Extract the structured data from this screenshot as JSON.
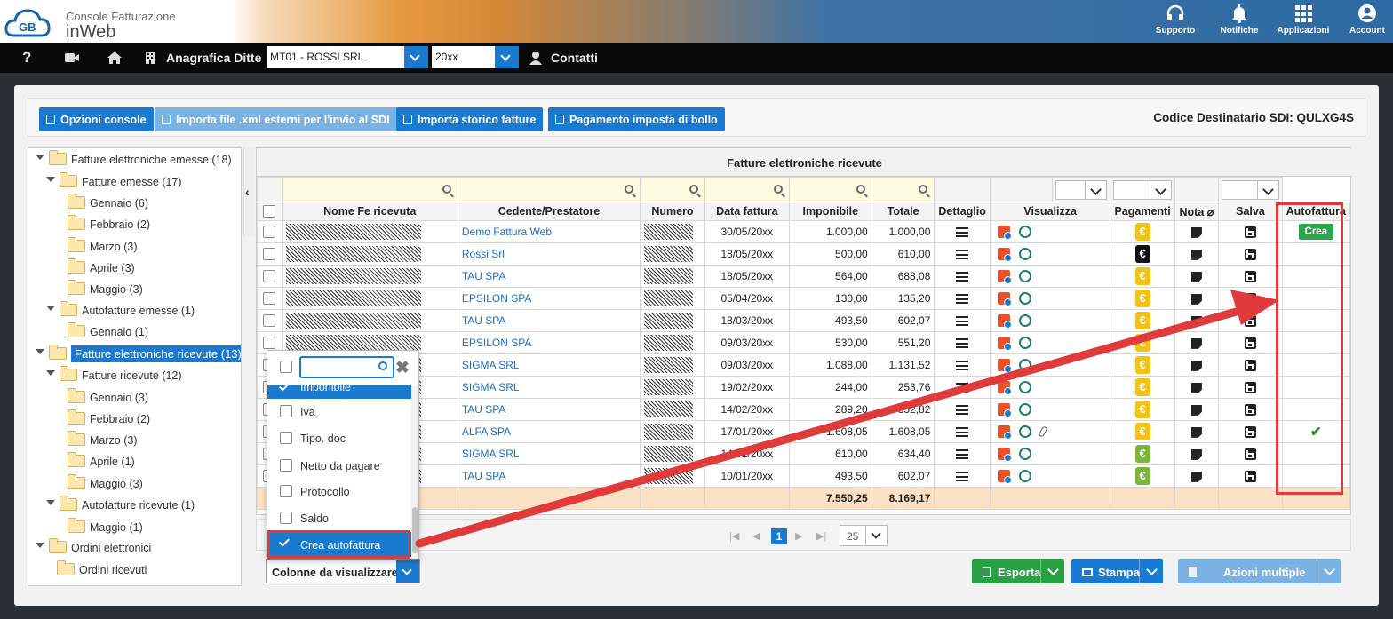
{
  "app": {
    "brand_line1": "Console Fatturazione",
    "brand_line2": "inWeb",
    "logo_text": "GB"
  },
  "top_actions": [
    {
      "label": "Supporto",
      "icon": "headset-icon"
    },
    {
      "label": "Notifiche",
      "icon": "bell-icon"
    },
    {
      "label": "Applicazioni",
      "icon": "apps-grid-icon"
    },
    {
      "label": "Account",
      "icon": "user-circle-icon"
    }
  ],
  "nav": {
    "help": "?",
    "anagrafica": "Anagrafica Ditte",
    "company_value": "MT01 - ROSSI SRL",
    "year_value": "20xx",
    "contatti": "Contatti"
  },
  "toolbar": {
    "buttons": [
      "Opzioni console",
      "Importa file .xml esterni per l'invio al SDI",
      "Importa storico fatture",
      "Pagamento imposta di bollo"
    ],
    "sdi": "Codice Destinatario SDI: QULXG4S"
  },
  "tree": [
    "Fatture elettroniche emesse (18)",
    "Fatture emesse (17)",
    "Gennaio (6)",
    "Febbraio (2)",
    "Marzo (3)",
    "Aprile (3)",
    "Maggio (3)",
    "Autofatture emesse (1)",
    "Gennaio (1)",
    "Fatture elettroniche ricevute (13)",
    "Fatture ricevute (12)",
    "Gennaio (3)",
    "Febbraio (2)",
    "Marzo (3)",
    "Aprile (1)",
    "Maggio (3)",
    "Autofatture ricevute (1)",
    "Maggio (1)",
    "Ordini elettronici",
    "Ordini ricevuti"
  ],
  "grid": {
    "title": "Fatture elettroniche ricevute",
    "columns": [
      "Nome Fe ricevuta",
      "Cedente/Prestatore",
      "Numero",
      "Data fattura",
      "Imponibile",
      "Totale",
      "Dettaglio",
      "Visualizza",
      "Pagamenti",
      "Nota",
      "Salva",
      "Autofattura"
    ],
    "rows": [
      {
        "cedente": "Demo Fattura Web",
        "data": "30/05/20xx",
        "imponibile": "1.000,00",
        "totale": "1.000,00",
        "pag": "yellow",
        "auto": "Crea"
      },
      {
        "cedente": "Rossi Srl",
        "data": "18/05/20xx",
        "imponibile": "500,00",
        "totale": "610,00",
        "pag": "black",
        "auto": ""
      },
      {
        "cedente": "TAU SPA",
        "data": "18/05/20xx",
        "imponibile": "564,00",
        "totale": "688,08",
        "pag": "yellow",
        "auto": ""
      },
      {
        "cedente": "EPSILON SPA",
        "data": "05/04/20xx",
        "imponibile": "130,00",
        "totale": "135,20",
        "pag": "yellow",
        "auto": ""
      },
      {
        "cedente": "TAU SPA",
        "data": "18/03/20xx",
        "imponibile": "493,50",
        "totale": "602,07",
        "pag": "yellow",
        "auto": ""
      },
      {
        "cedente": "EPSILON SPA",
        "data": "09/03/20xx",
        "imponibile": "530,00",
        "totale": "551,20",
        "pag": "yellow",
        "auto": ""
      },
      {
        "cedente": "SIGMA SRL",
        "data": "09/03/20xx",
        "imponibile": "1.088,00",
        "totale": "1.131,52",
        "pag": "yellow",
        "auto": ""
      },
      {
        "cedente": "SIGMA SRL",
        "data": "19/02/20xx",
        "imponibile": "244,00",
        "totale": "253,76",
        "pag": "yellow",
        "auto": ""
      },
      {
        "cedente": "TAU SPA",
        "data": "14/02/20xx",
        "imponibile": "289,20",
        "totale": "352,82",
        "pag": "yellow",
        "auto": ""
      },
      {
        "cedente": "ALFA SPA",
        "data": "17/01/20xx",
        "imponibile": "1.608,05",
        "totale": "1.608,05",
        "pag": "yellow",
        "auto": "✔",
        "clip": true
      },
      {
        "cedente": "SIGMA SRL",
        "data": "14/01/20xx",
        "imponibile": "610,00",
        "totale": "634,40",
        "pag": "green",
        "auto": ""
      },
      {
        "cedente": "TAU SPA",
        "data": "10/01/20xx",
        "imponibile": "493,50",
        "totale": "602,07",
        "pag": "green",
        "auto": ""
      }
    ],
    "totals": {
      "imponibile": "7.550,25",
      "totale": "8.169,17"
    }
  },
  "pager": {
    "current": "1",
    "page_size": "25"
  },
  "column_panel": {
    "options": [
      {
        "label": "Imponibile",
        "checked": true
      },
      {
        "label": "Iva",
        "checked": false
      },
      {
        "label": "Tipo. doc",
        "checked": false
      },
      {
        "label": "Netto da pagare",
        "checked": false
      },
      {
        "label": "Protocollo",
        "checked": false
      },
      {
        "label": "Saldo",
        "checked": false
      },
      {
        "label": "Crea autofattura",
        "checked": true
      }
    ]
  },
  "bottom": {
    "columns_select": "Colonne da visualizzare",
    "esporta": "Esporta",
    "stampa": "Stampa",
    "azioni": "Azioni multiple"
  },
  "colors": {
    "primary": "#1a7ad0",
    "highlight_red": "#e03a3a",
    "green": "#2da44e",
    "total_row": "#fde1c4"
  }
}
